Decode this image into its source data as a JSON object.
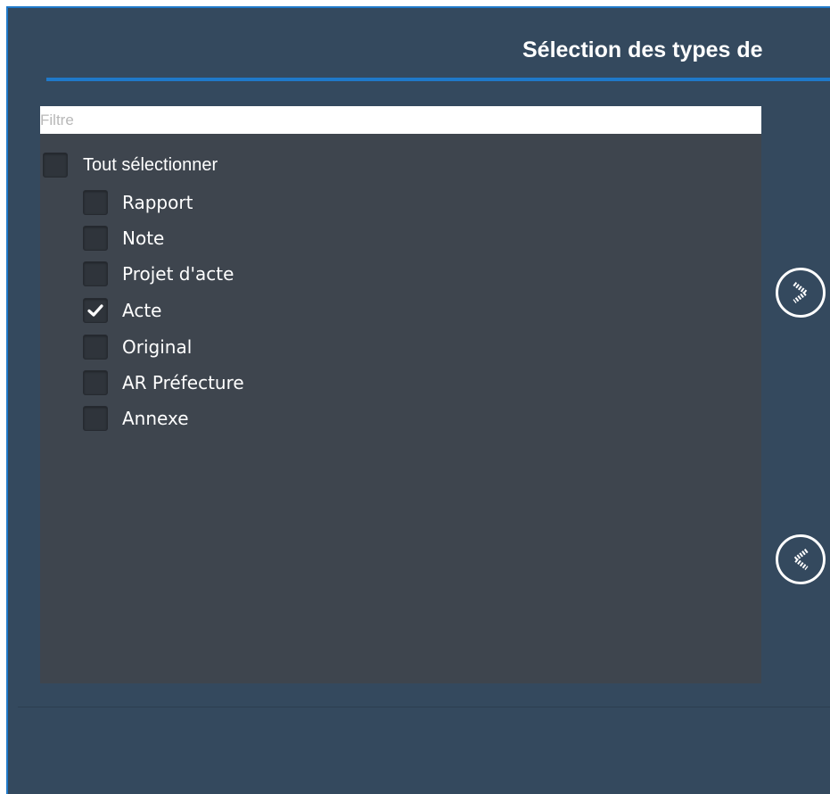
{
  "dialog": {
    "title": "Sélection des types de"
  },
  "filter": {
    "placeholder": "Filtre",
    "value": ""
  },
  "select_all": {
    "label": "Tout sélectionner",
    "checked": false
  },
  "items": [
    {
      "label": "Rapport",
      "checked": false
    },
    {
      "label": "Note",
      "checked": false
    },
    {
      "label": "Projet d'acte",
      "checked": false
    },
    {
      "label": "Acte",
      "checked": true
    },
    {
      "label": "Original",
      "checked": false
    },
    {
      "label": "AR Préfecture",
      "checked": false
    },
    {
      "label": "Annexe",
      "checked": false
    }
  ],
  "transfer_buttons": {
    "add_icon": "chevron-right-icon",
    "remove_icon": "chevron-left-icon"
  },
  "colors": {
    "window_background": "#34495e",
    "accent": "#1f79c9",
    "list_background": "#3e454e",
    "text": "#ffffff"
  }
}
